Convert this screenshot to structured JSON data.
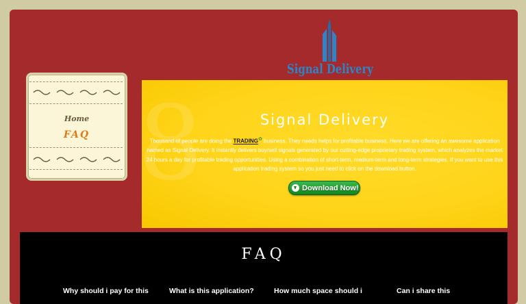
{
  "logo": {
    "text": "Signal Delivery",
    "icon": "skyscraper-logo-icon",
    "color": "#2a86c8"
  },
  "sidebar": {
    "nav": [
      {
        "label": "Home"
      },
      {
        "label": "FAQ"
      }
    ]
  },
  "hero": {
    "title": "Signal Delivery",
    "text_before": "Thousand of people are doing the ",
    "keyword": "TRADING",
    "text_after": " business. They needs helps for profitable business. Here we are offering an awesome application named as Signal Delivery. It instantly delivers buy/sell signals generated by our cutting-edge proprietary trading system, which analyzes the market 24 hours a day for profitable trading opportunities. Using a combination of short-term, medium-term and long-term strategies. If you want to use this application trading system so you just need to click on the download button.",
    "download_label": "Download Now!",
    "download_icon": "download-arrow-icon"
  },
  "faq": {
    "title": "FAQ",
    "questions": [
      "Why should i pay for this",
      "What is this application?",
      "How much space should i",
      "Can i share this"
    ]
  },
  "colors": {
    "page_bg": "#d0cba3",
    "panel_bg": "#a42a2c",
    "hero_bg": "#ffd41a",
    "button": "#1f9a2c",
    "faq_bg": "#000000"
  }
}
